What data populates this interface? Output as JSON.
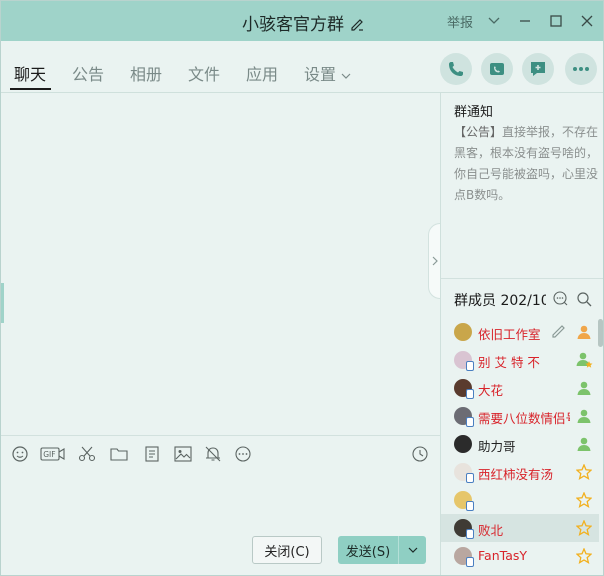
{
  "window": {
    "title": "小骇客官方群",
    "report_label": "举报"
  },
  "tabs": [
    {
      "label": "聊天",
      "active": true
    },
    {
      "label": "公告",
      "active": false
    },
    {
      "label": "相册",
      "active": false
    },
    {
      "label": "文件",
      "active": false
    },
    {
      "label": "应用",
      "active": false
    },
    {
      "label": "设置",
      "active": false
    }
  ],
  "header_actions": [
    "phone-icon",
    "video-call-icon",
    "message-add-icon",
    "more-icon"
  ],
  "toolbar_icons": [
    "emoji-icon",
    "gif-icon",
    "scissors-icon",
    "folder-icon",
    "document-icon",
    "image-icon",
    "bell-mute-icon",
    "more-circle-icon",
    "history-clock-icon"
  ],
  "toolbar_gif_label": "GIF",
  "buttons": {
    "close": "关闭(C)",
    "send": "发送(S)"
  },
  "notice": {
    "title": "群通知",
    "bracket": "【公告】",
    "text": "直接举报，不存在黑客，根本没有盗号啥的，你自己号能被盗吗，心里没点B数吗。"
  },
  "members": {
    "header": "群成员 202/10",
    "list": [
      {
        "name": "依旧工作室",
        "color": "red",
        "role": "owner",
        "avatar_color": "#c9a64a",
        "mobile": false,
        "editable": true
      },
      {
        "name": "别  艾 特  不",
        "color": "red",
        "role": "admin-star",
        "avatar_color": "#d9c4d2",
        "mobile": true,
        "editable": false
      },
      {
        "name": "大花",
        "color": "red",
        "role": "admin",
        "avatar_color": "#5a3b2e",
        "mobile": true,
        "editable": false
      },
      {
        "name": "需要八位数情侣号",
        "color": "red",
        "role": "admin",
        "avatar_color": "#6c6c74",
        "mobile": true,
        "editable": false
      },
      {
        "name": "助力哥",
        "color": "dark",
        "role": "admin",
        "avatar_color": "#2b2b2b",
        "mobile": false,
        "editable": false
      },
      {
        "name": "西红柿没有汤",
        "color": "red",
        "role": "star",
        "avatar_color": "#e8e3dd",
        "mobile": true,
        "editable": false
      },
      {
        "name": "",
        "color": "red",
        "role": "star",
        "avatar_color": "#e6c66a",
        "mobile": true,
        "editable": false
      },
      {
        "name": "败北",
        "color": "red",
        "role": "star",
        "avatar_color": "#3f3b35",
        "mobile": true,
        "editable": false,
        "selected": true
      },
      {
        "name": "FanTasY",
        "color": "red",
        "role": "star",
        "avatar_color": "#b9a7a0",
        "mobile": true,
        "editable": false
      }
    ]
  },
  "colors": {
    "titlebar": "#9fd3c9",
    "background": "#eaf3f1",
    "member_red": "#d8232a",
    "send_button": "#8fcfc3",
    "star": "#f2b01e"
  }
}
